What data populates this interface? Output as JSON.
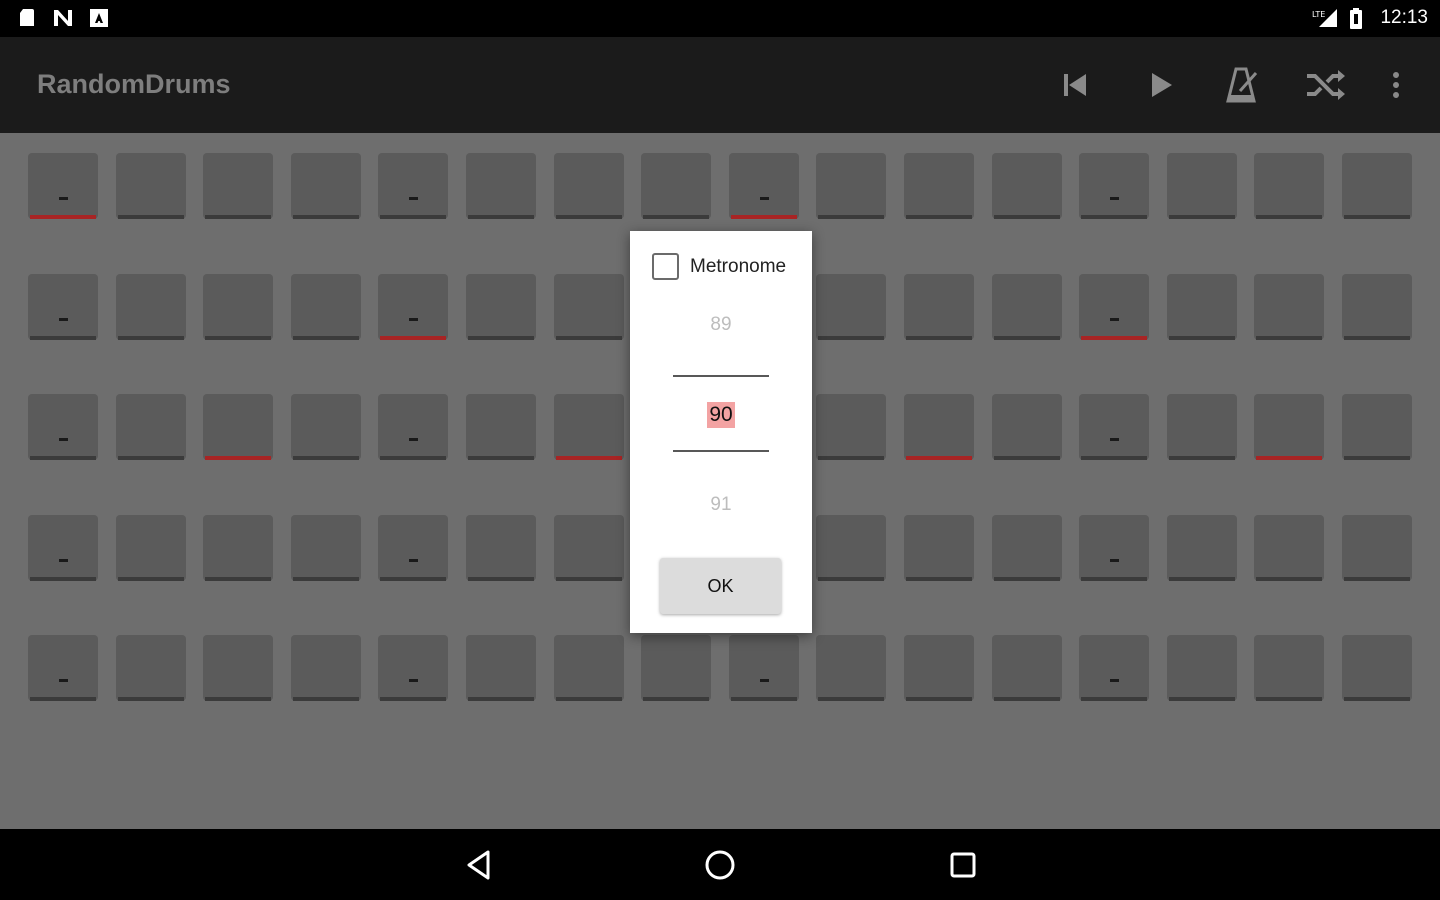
{
  "status_bar": {
    "time": "12:13",
    "icons_left": [
      "sd-card-icon",
      "nfc-icon",
      "a-notification-icon"
    ],
    "icons_right": [
      "signal-icon",
      "battery-icon"
    ]
  },
  "app_bar": {
    "title": "RandomDrums",
    "actions": [
      "skip-previous-icon",
      "play-icon",
      "metronome-icon",
      "shuffle-icon",
      "overflow-menu-icon"
    ]
  },
  "grid": {
    "rows": 5,
    "cols": 16,
    "active_color": "#a82424",
    "active": [
      [
        0,
        8
      ],
      [
        4,
        12
      ],
      [
        2,
        6,
        10,
        14
      ],
      [],
      []
    ],
    "marked": [
      [
        0,
        4,
        8,
        12
      ],
      [
        0,
        4,
        12
      ],
      [
        0,
        4,
        12
      ],
      [
        0,
        4,
        12
      ],
      [
        0,
        4,
        8,
        12
      ]
    ]
  },
  "dialog": {
    "checkbox_label": "Metronome",
    "checkbox_checked": false,
    "prev_value": "89",
    "current_value": "90",
    "next_value": "91",
    "ok_label": "OK"
  },
  "nav_bar": {
    "buttons": [
      "back-icon",
      "home-icon",
      "recents-icon"
    ]
  }
}
